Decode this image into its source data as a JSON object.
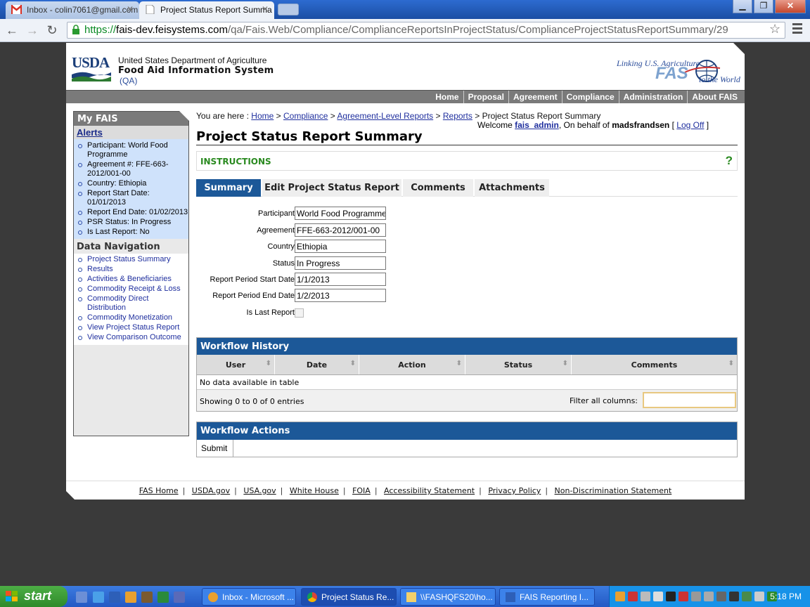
{
  "browser": {
    "tabs": [
      {
        "title": "Inbox - colin7061@gmail.com"
      },
      {
        "title": "Project Status Report Summa"
      }
    ],
    "url": {
      "scheme": "https://",
      "host": "fais-dev.feisystems.com",
      "path": "/qa/Fais.Web/Compliance/ComplianceReportsInProjectStatus/ComplianceProjectStatusReportSummary/29"
    },
    "window_buttons": {
      "minimize": "▁",
      "maximize": "❐",
      "close": "✕"
    }
  },
  "header": {
    "logo_text": "USDA",
    "org_line1": "United States Department of Agriculture",
    "org_line2": "Food Aid Information System",
    "org_line3": "(QA)",
    "fas_tag1": "Linking U.S. Agriculture",
    "fas_big": "FAS",
    "fas_tag2": "to the World"
  },
  "topmenu": [
    "Home",
    "Proposal",
    "Agreement",
    "Compliance",
    "Administration",
    "About FAIS"
  ],
  "sidebar": {
    "title": "My FAIS",
    "alerts_title": "Alerts",
    "alerts": [
      "Participant: World Food Programme",
      "Agreement #: FFE-663-2012/001-00",
      "Country: Ethiopia",
      "Report Start Date: 01/01/2013",
      "Report End Date: 01/02/2013",
      "PSR Status: In Progress",
      "Is Last Report: No"
    ],
    "data_nav_title": "Data Navigation",
    "data_nav": [
      "Project Status Summary",
      "Results",
      "Activities & Beneficiaries",
      "Commodity Receipt & Loss",
      "Commodity Direct Distribution",
      "Commodity Monetization",
      "View Project Status Report",
      "View Comparison Outcome"
    ]
  },
  "breadcrumb": {
    "prefix": "You are here :",
    "links": [
      "Home",
      "Compliance",
      "Agreement-Level Reports",
      "Reports"
    ],
    "current": "Project Status Report Summary",
    "sep": ">"
  },
  "welcome": {
    "label": "Welcome",
    "user": "fais_admin",
    "behalf_label": ", On behalf of",
    "behalf_user": "madsfrandsen",
    "logoff": "Log Off"
  },
  "page_title": "Project Status Report Summary",
  "instructions": {
    "label": "INSTRUCTIONS",
    "help": "?"
  },
  "tabs": [
    "Summary",
    "Edit Project Status Report",
    "Comments",
    "Attachments"
  ],
  "form": {
    "participant": {
      "label": "Participant",
      "value": "World Food Programme"
    },
    "agreement": {
      "label": "Agreement",
      "value": "FFE-663-2012/001-00"
    },
    "country": {
      "label": "Country",
      "value": "Ethiopia"
    },
    "status": {
      "label": "Status",
      "value": "In Progress"
    },
    "start": {
      "label": "Report Period Start Date",
      "value": "1/1/2013"
    },
    "end": {
      "label": "Report Period End Date",
      "value": "1/2/2013"
    },
    "last": {
      "label": "Is Last Report",
      "checked": false
    }
  },
  "workflow_history": {
    "title": "Workflow History",
    "columns": [
      "User",
      "Date",
      "Action",
      "Status",
      "Comments"
    ],
    "empty": "No data available in table",
    "showing": "Showing 0 to 0 of 0 entries",
    "filter_label": "Filter all columns:",
    "filter_value": ""
  },
  "workflow_actions": {
    "title": "Workflow Actions",
    "submit": "Submit"
  },
  "footer": [
    "FAS Home",
    "USDA.gov",
    "USA.gov",
    "White House",
    "FOIA",
    "Accessibility Statement",
    "Privacy Policy",
    "Non-Discrimination Statement"
  ],
  "taskbar": {
    "start": "start",
    "tasks": [
      "Inbox - Microsoft ...",
      "Project Status Re...",
      "\\\\FASHQFS20\\ho...",
      "FAIS Reporting I..."
    ],
    "clock": "5:18 PM"
  }
}
